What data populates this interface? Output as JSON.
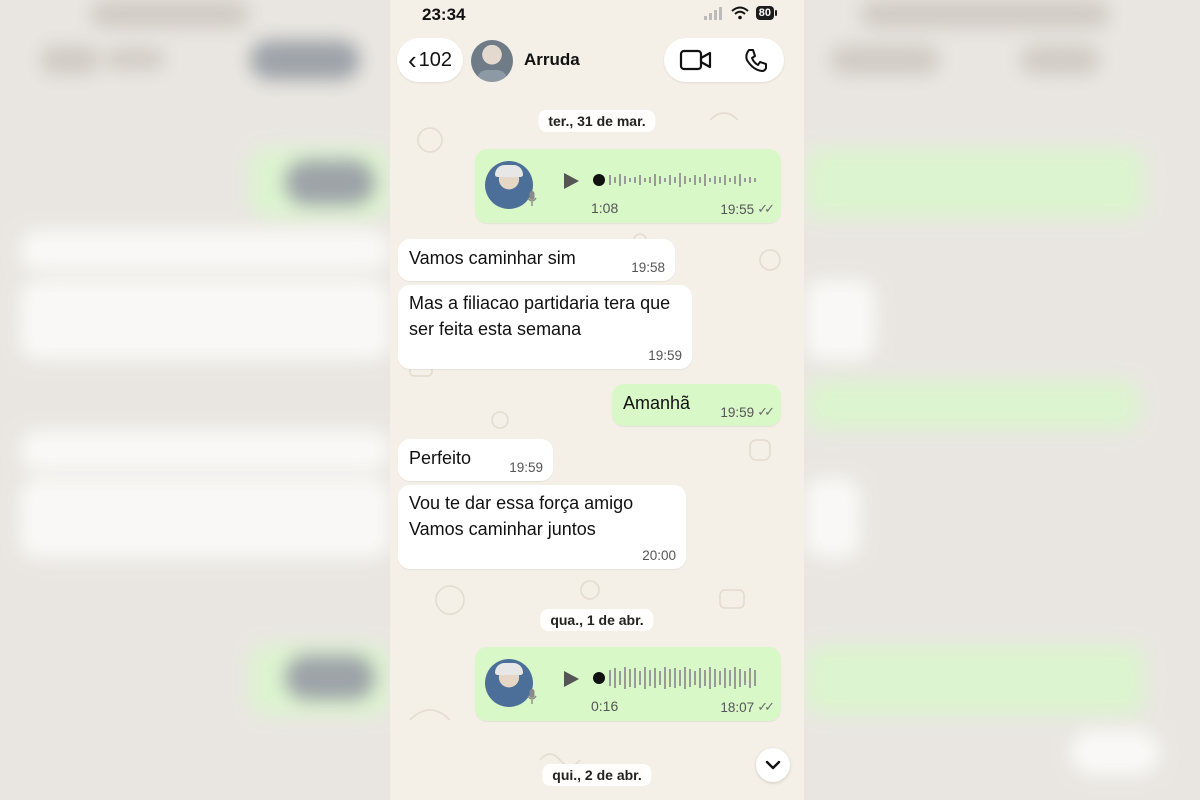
{
  "status_bar": {
    "time": "23:34",
    "battery": "80"
  },
  "header": {
    "back_count": "102",
    "contact_name": "Arruda"
  },
  "day_chips": {
    "first": "ter., 31 de mar.",
    "second": "qua., 1 de abr.",
    "third": "qui., 2 de abr."
  },
  "messages": [
    {
      "type": "voice",
      "direction": "out",
      "duration": "1:08",
      "time": "19:55",
      "status": "read"
    },
    {
      "type": "text",
      "direction": "in",
      "text": "Vamos caminhar sim",
      "time": "19:58"
    },
    {
      "type": "text",
      "direction": "in",
      "text": "Mas a filiacao partidaria tera que ser feita esta semana",
      "time": "19:59"
    },
    {
      "type": "text",
      "direction": "out",
      "text": "Amanhã",
      "time": "19:59",
      "status": "read"
    },
    {
      "type": "text",
      "direction": "in",
      "text": "Perfeito",
      "time": "19:59"
    },
    {
      "type": "text",
      "direction": "in",
      "text": "Vou te dar essa força amigo Vamos caminhar juntos",
      "time": "20:00"
    },
    {
      "type": "voice",
      "direction": "out",
      "duration": "0:16",
      "time": "18:07",
      "status": "read"
    }
  ],
  "icons": {
    "back": "chevron-left-icon",
    "video_call": "video-call-icon",
    "voice_call": "phone-icon",
    "play": "play-icon",
    "mic": "microphone-icon",
    "ticks": "double-check-icon",
    "scroll": "chevron-down-icon"
  },
  "colors": {
    "incoming_bubble": "#ffffff",
    "outgoing_bubble": "#d9f8c8",
    "chat_background": "#f4efe7",
    "read_ticks": "#6b6b6b"
  }
}
